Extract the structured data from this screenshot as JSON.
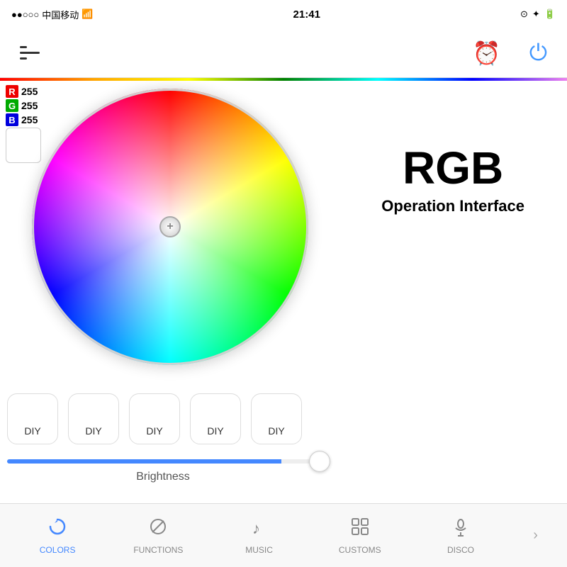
{
  "status_bar": {
    "signal": "●●○○○",
    "carrier": "中国移动",
    "wifi": "WiFi",
    "time": "21:41",
    "battery": "100%"
  },
  "nav": {
    "menu_label": "Menu",
    "alarm_label": "Alarm",
    "power_label": "Power"
  },
  "rgb": {
    "r_label": "R",
    "g_label": "G",
    "b_label": "B",
    "r_value": "255",
    "g_value": "255",
    "b_value": "255"
  },
  "main_title": "RGB",
  "sub_title": "Operation Interface",
  "diy_buttons": [
    {
      "label": "DIY"
    },
    {
      "label": "DIY"
    },
    {
      "label": "DIY"
    },
    {
      "label": "DIY"
    },
    {
      "label": "DIY"
    }
  ],
  "brightness": {
    "label": "Brightness",
    "value": 88
  },
  "tabs": [
    {
      "id": "colors",
      "label": "COLORS",
      "icon": "arc",
      "active": true
    },
    {
      "id": "functions",
      "label": "FUNCTIONS",
      "icon": "circle-slash",
      "active": false
    },
    {
      "id": "music",
      "label": "MUSIC",
      "icon": "music",
      "active": false
    },
    {
      "id": "customs",
      "label": "CUSTOMS",
      "icon": "grid",
      "active": false
    },
    {
      "id": "disco",
      "label": "DISCO",
      "icon": "mic",
      "active": false
    }
  ]
}
